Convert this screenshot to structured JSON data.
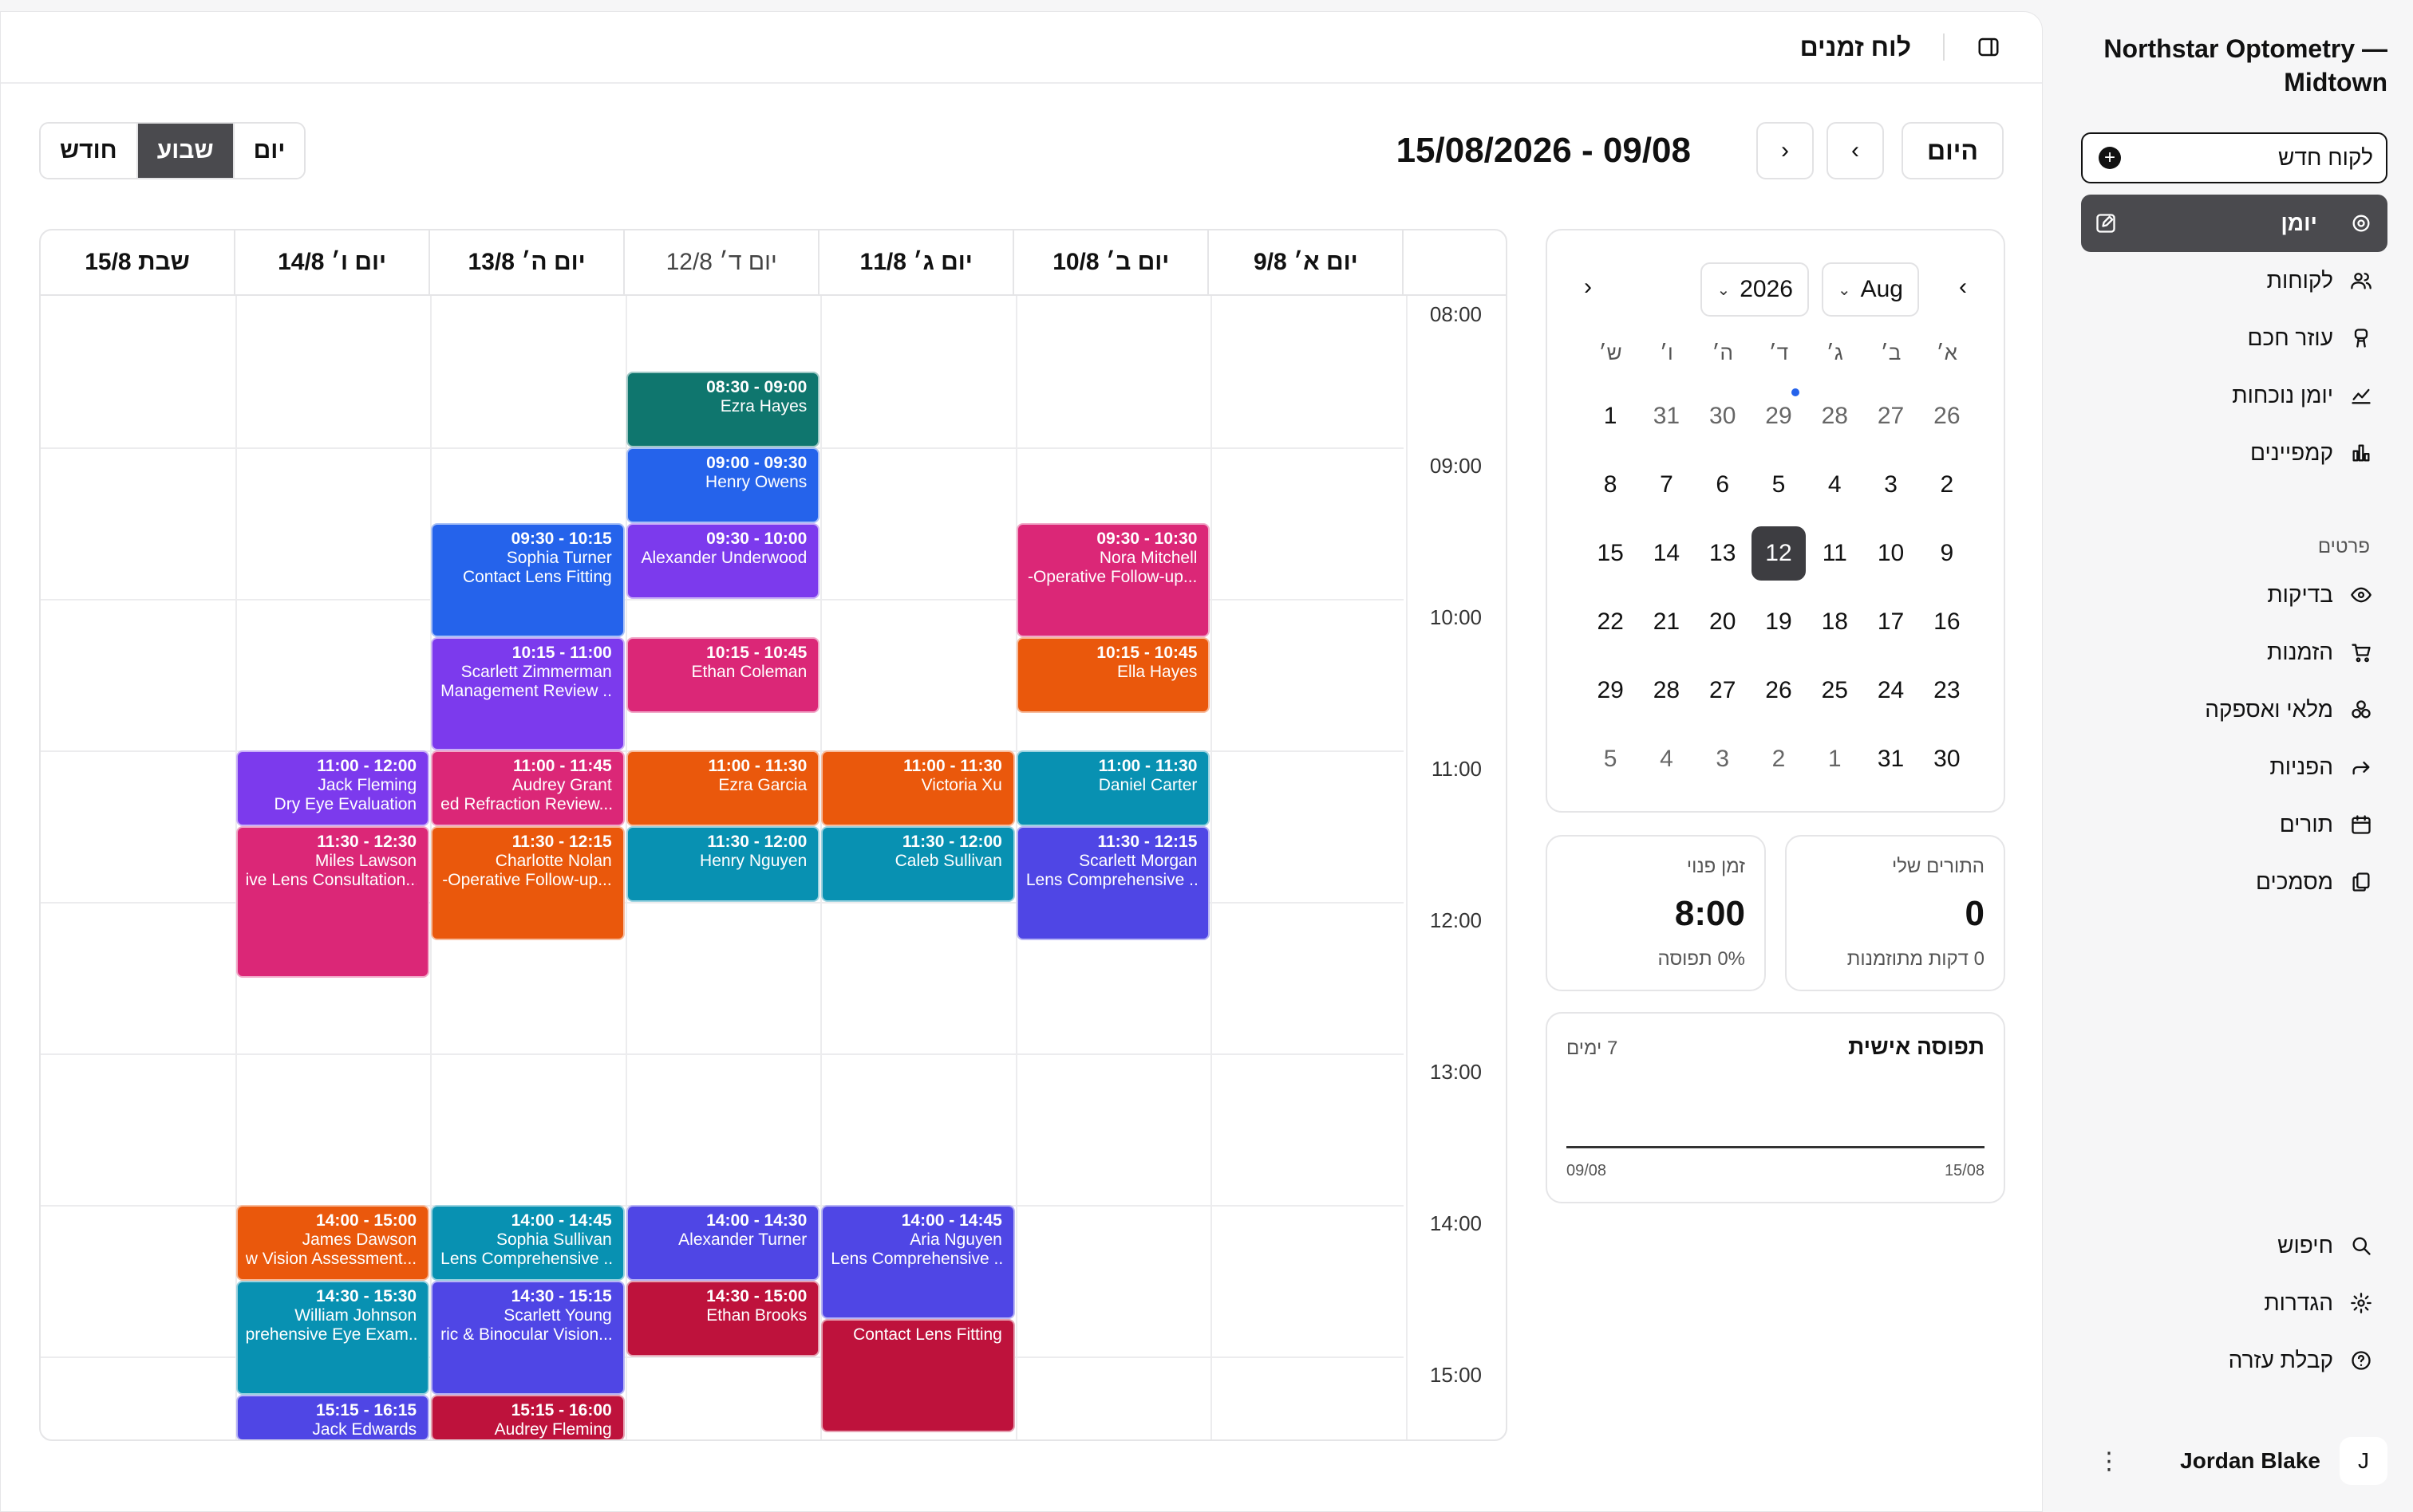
{
  "sidebar": {
    "org_name": "Northstar Optometry — Midtown",
    "new_client": "לקוח חדש",
    "nav": [
      {
        "label": "יומן",
        "icon": "edit-icon",
        "active": true
      },
      {
        "label": "לקוחות",
        "icon": "users-icon"
      },
      {
        "label": "עוזר חכם",
        "icon": "robot-icon"
      },
      {
        "label": "יומן נוכחות",
        "icon": "chart-line-icon"
      },
      {
        "label": "קמפיינים",
        "icon": "bar-chart-icon"
      }
    ],
    "section_title": "פרטים",
    "details": [
      {
        "label": "בדיקות",
        "icon": "eye-icon"
      },
      {
        "label": "הזמנות",
        "icon": "cart-icon"
      },
      {
        "label": "מלאי ואספקה",
        "icon": "boxes-icon"
      },
      {
        "label": "הפניות",
        "icon": "forward-icon"
      },
      {
        "label": "תורים",
        "icon": "calendar-icon"
      },
      {
        "label": "מסמכים",
        "icon": "documents-icon"
      }
    ],
    "bottom": [
      {
        "label": "חיפוש",
        "icon": "search-icon"
      },
      {
        "label": "הגדרות",
        "icon": "gear-icon"
      },
      {
        "label": "קבלת עזרה",
        "icon": "help-icon"
      }
    ],
    "user": {
      "name": "Jordan Blake",
      "initial": "J"
    }
  },
  "header": {
    "title": "לוח זמנים"
  },
  "toolbar": {
    "today": "היום",
    "range": "15/08/2026 - 09/08",
    "views": [
      "יום",
      "שבוע",
      "חודש"
    ],
    "active_view": "שבוע"
  },
  "week": {
    "days": [
      "יום א׳ 9/8",
      "יום ב׳ 10/8",
      "יום ג׳ 11/8",
      "יום ד׳ 12/8",
      "יום ה׳ 13/8",
      "יום ו׳ 14/8",
      "שבת 15/8"
    ],
    "today_index": 3,
    "hours": [
      "08:00",
      "09:00",
      "10:00",
      "11:00",
      "12:00",
      "13:00",
      "14:00",
      "15:00"
    ],
    "appointments": [
      {
        "day": 3,
        "start": 8.5,
        "end": 9.0,
        "time": "08:30 - 09:00",
        "name": "Ezra Hayes",
        "service": "",
        "color": "#0f766e"
      },
      {
        "day": 3,
        "start": 9.0,
        "end": 9.5,
        "time": "09:00 - 09:30",
        "name": "Henry Owens",
        "service": "",
        "color": "#2563eb"
      },
      {
        "day": 3,
        "start": 9.5,
        "end": 10.0,
        "time": "09:30 - 10:00",
        "name": "Alexander Underwood",
        "service": "",
        "color": "#7c3aed"
      },
      {
        "day": 3,
        "start": 10.25,
        "end": 10.75,
        "time": "10:15 - 10:45",
        "name": "Ethan Coleman",
        "service": "",
        "color": "#db2777"
      },
      {
        "day": 3,
        "start": 11.0,
        "end": 11.5,
        "time": "11:00 - 11:30",
        "name": "Ezra Garcia",
        "service": "",
        "color": "#ea580c"
      },
      {
        "day": 3,
        "start": 11.5,
        "end": 12.0,
        "time": "11:30 - 12:00",
        "name": "Henry Nguyen",
        "service": "",
        "color": "#0891b2"
      },
      {
        "day": 3,
        "start": 14.0,
        "end": 14.5,
        "time": "14:00 - 14:30",
        "name": "Alexander Turner",
        "service": "",
        "color": "#4f46e5"
      },
      {
        "day": 3,
        "start": 14.5,
        "end": 15.0,
        "time": "14:30 - 15:00",
        "name": "Ethan Brooks",
        "service": "",
        "color": "#be123c"
      },
      {
        "day": 4,
        "start": 9.5,
        "end": 10.25,
        "time": "09:30 - 10:15",
        "name": "Sophia Turner",
        "service": "Contact Lens Fitting",
        "color": "#2563eb"
      },
      {
        "day": 4,
        "start": 10.25,
        "end": 11.0,
        "time": "10:15 - 11:00",
        "name": "Scarlett Zimmerman",
        "service": "Management Review ...",
        "color": "#7c3aed"
      },
      {
        "day": 4,
        "start": 11.0,
        "end": 11.5,
        "time": "11:00 - 11:45",
        "name": "Audrey Grant",
        "service": "ed Refraction Review...",
        "color": "#db2777"
      },
      {
        "day": 4,
        "start": 11.5,
        "end": 12.25,
        "time": "11:30 - 12:15",
        "name": "Charlotte Nolan",
        "service": "-Operative Follow-up...",
        "color": "#ea580c"
      },
      {
        "day": 4,
        "start": 14.0,
        "end": 14.5,
        "time": "14:00 - 14:45",
        "name": "Sophia Sullivan",
        "service": "Lens Comprehensive ...",
        "color": "#0891b2"
      },
      {
        "day": 4,
        "start": 14.5,
        "end": 15.25,
        "time": "14:30 - 15:15",
        "name": "Scarlett Young",
        "service": "ric & Binocular Vision...",
        "color": "#4f46e5"
      },
      {
        "day": 4,
        "start": 15.25,
        "end": 15.75,
        "time": "15:15 - 16:00",
        "name": "Audrey Fleming",
        "service": "",
        "color": "#be123c"
      },
      {
        "day": 5,
        "start": 11.0,
        "end": 11.5,
        "time": "11:00 - 12:00",
        "name": "Jack Fleming",
        "service": "Dry Eye Evaluation",
        "color": "#7c3aed"
      },
      {
        "day": 5,
        "start": 11.5,
        "end": 12.5,
        "time": "11:30 - 12:30",
        "name": "Miles Lawson",
        "service": "ive Lens Consultation...",
        "color": "#db2777"
      },
      {
        "day": 5,
        "start": 14.0,
        "end": 14.5,
        "time": "14:00 - 15:00",
        "name": "James Dawson",
        "service": "w Vision Assessment...",
        "color": "#ea580c"
      },
      {
        "day": 5,
        "start": 14.5,
        "end": 15.25,
        "time": "14:30 - 15:30",
        "name": "William Johnson",
        "service": "prehensive Eye Exam...",
        "color": "#0891b2"
      },
      {
        "day": 5,
        "start": 15.25,
        "end": 15.75,
        "time": "15:15 - 16:15",
        "name": "Jack Edwards",
        "service": "",
        "color": "#4f46e5"
      },
      {
        "day": 2,
        "start": 11.0,
        "end": 11.5,
        "time": "11:00 - 11:30",
        "name": "Victoria Xu",
        "service": "",
        "color": "#ea580c"
      },
      {
        "day": 2,
        "start": 11.5,
        "end": 12.0,
        "time": "11:30 - 12:00",
        "name": "Caleb Sullivan",
        "service": "",
        "color": "#0891b2"
      },
      {
        "day": 2,
        "start": 14.75,
        "end": 15.5,
        "time": "",
        "name": "",
        "service": "Contact Lens Fitting",
        "color": "#be123c"
      },
      {
        "day": 2,
        "start": 14.0,
        "end": 14.75,
        "time": "14:00 - 14:45",
        "name": "Aria Nguyen",
        "service": "Lens Comprehensive ...",
        "color": "#4f46e5"
      },
      {
        "day": 1,
        "start": 9.5,
        "end": 10.25,
        "time": "09:30 - 10:30",
        "name": "Nora Mitchell",
        "service": "-Operative Follow-up...",
        "color": "#db2777"
      },
      {
        "day": 1,
        "start": 10.25,
        "end": 10.75,
        "time": "10:15 - 10:45",
        "name": "Ella Hayes",
        "service": "",
        "color": "#ea580c"
      },
      {
        "day": 1,
        "start": 11.0,
        "end": 11.5,
        "time": "11:00 - 11:30",
        "name": "Daniel Carter",
        "service": "",
        "color": "#0891b2"
      },
      {
        "day": 1,
        "start": 11.5,
        "end": 12.25,
        "time": "11:30 - 12:15",
        "name": "Scarlett Morgan",
        "service": "Lens Comprehensive ...",
        "color": "#4f46e5"
      }
    ]
  },
  "mini_calendar": {
    "month": "Aug",
    "year": "2026",
    "dow": [
      "א׳",
      "ב׳",
      "ג׳",
      "ד׳",
      "ה׳",
      "ו׳",
      "ש׳"
    ],
    "weeks": [
      [
        {
          "d": "26",
          "o": true
        },
        {
          "d": "27",
          "o": true
        },
        {
          "d": "28",
          "o": true
        },
        {
          "d": "29",
          "o": true,
          "dot": true
        },
        {
          "d": "30",
          "o": true
        },
        {
          "d": "31",
          "o": true
        },
        {
          "d": "1"
        }
      ],
      [
        {
          "d": "2"
        },
        {
          "d": "3"
        },
        {
          "d": "4"
        },
        {
          "d": "5"
        },
        {
          "d": "6"
        },
        {
          "d": "7"
        },
        {
          "d": "8"
        }
      ],
      [
        {
          "d": "9"
        },
        {
          "d": "10"
        },
        {
          "d": "11"
        },
        {
          "d": "12",
          "sel": true
        },
        {
          "d": "13"
        },
        {
          "d": "14"
        },
        {
          "d": "15"
        }
      ],
      [
        {
          "d": "16"
        },
        {
          "d": "17"
        },
        {
          "d": "18"
        },
        {
          "d": "19"
        },
        {
          "d": "20"
        },
        {
          "d": "21"
        },
        {
          "d": "22"
        }
      ],
      [
        {
          "d": "23"
        },
        {
          "d": "24"
        },
        {
          "d": "25"
        },
        {
          "d": "26"
        },
        {
          "d": "27"
        },
        {
          "d": "28"
        },
        {
          "d": "29"
        }
      ],
      [
        {
          "d": "30"
        },
        {
          "d": "31"
        },
        {
          "d": "1",
          "o": true
        },
        {
          "d": "2",
          "o": true
        },
        {
          "d": "3",
          "o": true
        },
        {
          "d": "4",
          "o": true
        },
        {
          "d": "5",
          "o": true
        }
      ]
    ]
  },
  "stats": {
    "my_appointments": {
      "label": "התורים שלי",
      "value": "0",
      "sub": "0 דקות מתוזמנות"
    },
    "free_time": {
      "label": "זמן פנוי",
      "value": "8:00",
      "sub": "0% תפוסה"
    }
  },
  "occupancy": {
    "title": "תפוסה אישית",
    "range": "7 ימים",
    "x_start": "09/08",
    "x_end": "15/08",
    "values": [
      0,
      0,
      0,
      0,
      0,
      0,
      0
    ]
  }
}
